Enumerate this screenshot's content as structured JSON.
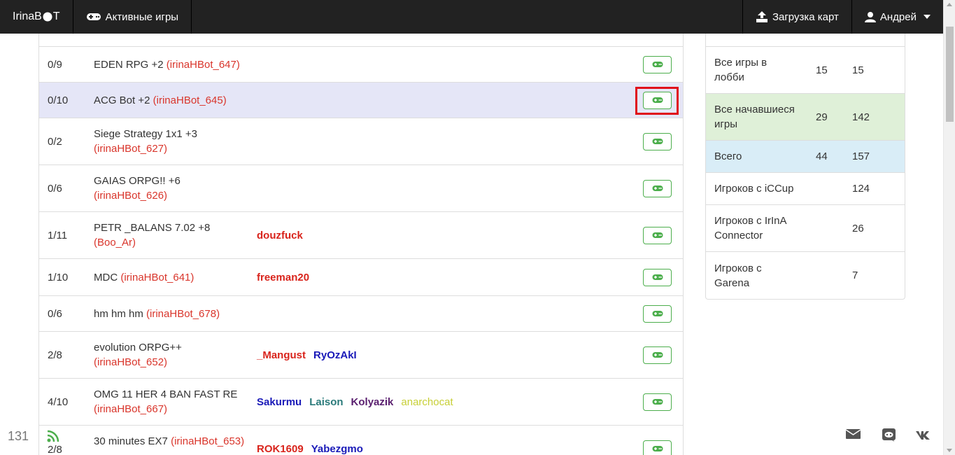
{
  "navbar": {
    "brand": "IrinaB",
    "brand_suffix": "T",
    "active_games": "Активные игры",
    "upload_maps": "Загрузка карт",
    "user": "Андрей"
  },
  "games": [
    {
      "slots": "0/9",
      "name": "EDEN RPG +2",
      "host": "(irinaHBot_647)",
      "players": []
    },
    {
      "slots": "0/10",
      "name": "ACG Bot +2",
      "host": "(irinaHBot_645)",
      "players": []
    },
    {
      "slots": "0/2",
      "name": "Siege Strategy 1x1 +3",
      "host": "(irinaHBot_627)",
      "players": []
    },
    {
      "slots": "0/6",
      "name": "GAIAS ORPG!! +6",
      "host": "(irinaHBot_626)",
      "players": []
    },
    {
      "slots": "1/11",
      "name": "PETR _BALANS 7.02 +8",
      "host": "(Boo_Ar)",
      "players": [
        {
          "name": "douzfuck",
          "color": "red"
        }
      ]
    },
    {
      "slots": "1/10",
      "name": "MDC",
      "host": "(irinaHBot_641)",
      "players": [
        {
          "name": "freeman20",
          "color": "red"
        }
      ]
    },
    {
      "slots": "0/6",
      "name": "hm hm hm",
      "host": "(irinaHBot_678)",
      "players": []
    },
    {
      "slots": "2/8",
      "name": "evolution ORPG++",
      "host": "(irinaHBot_652)",
      "players": [
        {
          "name": "_Mangust",
          "color": "red"
        },
        {
          "name": "RyOzAkI",
          "color": "blue"
        }
      ]
    },
    {
      "slots": "4/10",
      "name": "OMG 11 HER 4 BAN FAST RE",
      "host": "(irinaHBot_667)",
      "players": [
        {
          "name": "Sakurmu",
          "color": "blue"
        },
        {
          "name": "Laison",
          "color": "teal"
        },
        {
          "name": "Kolyazik",
          "color": "purple"
        },
        {
          "name": "anarchocat",
          "color": "yellow"
        }
      ]
    },
    {
      "slots": "2/8",
      "name": "30 minutes EX7",
      "host": "(irinaHBot_653)",
      "players": [
        {
          "name": "ROK1609",
          "color": "red"
        },
        {
          "name": "Yabezgmo",
          "color": "blue"
        }
      ]
    }
  ],
  "stats": [
    {
      "label": "Все игры в лобби",
      "v1": "15",
      "v2": "15"
    },
    {
      "label": "Все начавшиеся игры",
      "v1": "29",
      "v2": "142"
    },
    {
      "label": "Всего",
      "v1": "44",
      "v2": "157"
    },
    {
      "label": "Игроков с iCCup",
      "v1": "",
      "v2": "124"
    },
    {
      "label": "Игроков с IrInA Connector",
      "v1": "",
      "v2": "26"
    },
    {
      "label": "Игроков с Garena",
      "v1": "",
      "v2": "7"
    }
  ],
  "footer": {
    "count": "131"
  },
  "colors": {
    "navbar": "#222222",
    "host": "#d9352b",
    "join_border": "#4cae4c",
    "active_row": "#e5e6f7",
    "highlight": "#e0101a",
    "stat_green": "#dff0d8",
    "stat_blue": "#d9edf7"
  },
  "icons": {
    "join": "gamepad-icon",
    "upload": "upload-icon",
    "user": "user-icon",
    "rss": "rss-icon",
    "mail": "envelope-icon",
    "discord": "discord-icon",
    "vk": "vk-icon"
  }
}
